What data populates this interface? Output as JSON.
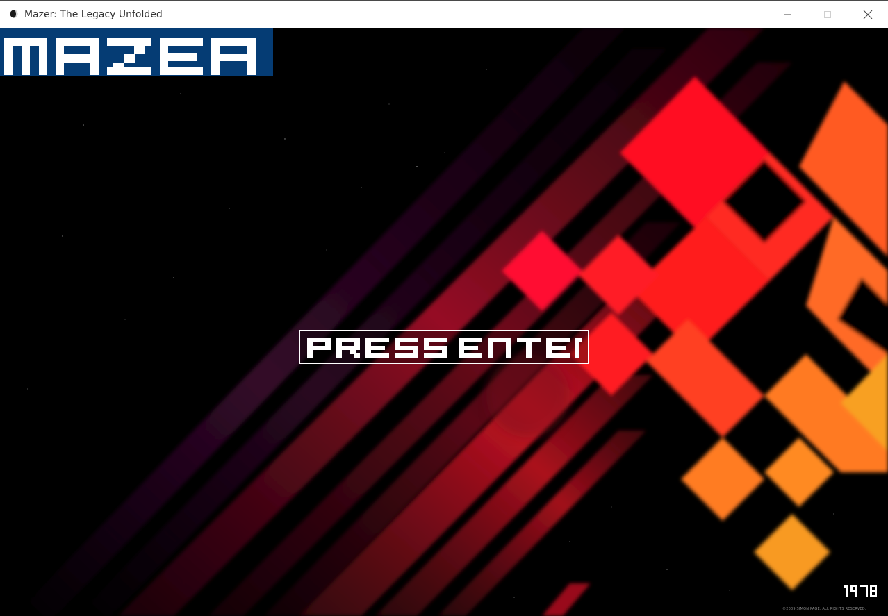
{
  "window": {
    "title": "Mazer: The Legacy Unfolded",
    "icon": "app-sphere-icon",
    "controls": [
      "minimize-icon",
      "maximize-icon",
      "close-icon"
    ]
  },
  "game": {
    "logo_text": "MAZER",
    "prompt_label": "PRESS ENTER",
    "year_badge": "1978",
    "copyright": "©2009 SIMON PAGE. ALL RIGHTS RESERVED.",
    "colors": {
      "logo_background": "#053c74",
      "logo_text": "#ffffff",
      "prompt_text": "#ffffff",
      "accent_red": "#ff1020",
      "accent_orange": "#f8a020"
    }
  }
}
